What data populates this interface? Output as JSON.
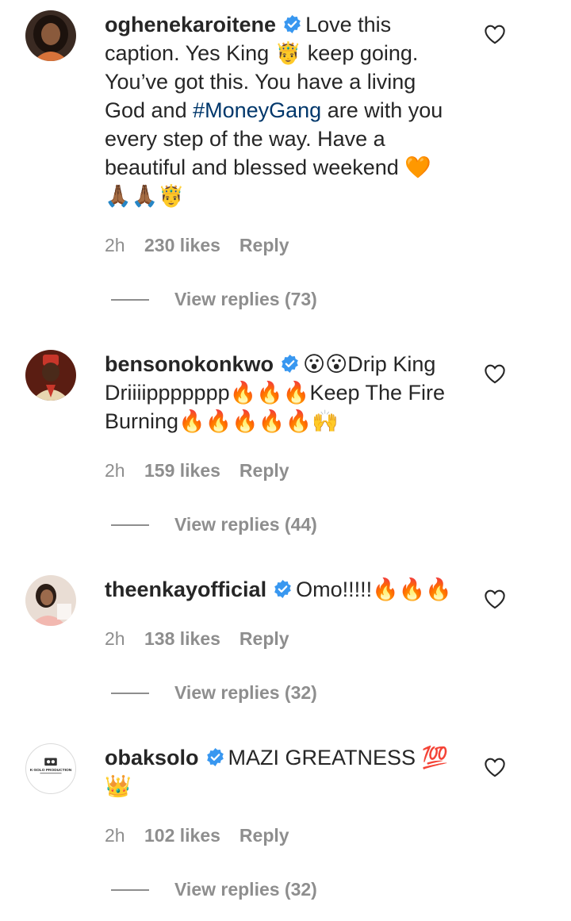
{
  "comments": [
    {
      "username": "oghenekaroitene",
      "text_before": "Love this caption. Yes King 🤴 keep going. You’ve got this. You have a living God and ",
      "hashtag": "#MoneyGang",
      "text_after": " are with you every step of the way. Have a beautiful and blessed weekend 🧡 🙏🏾🙏🏾🤴",
      "time": "2h",
      "likes": "230 likes",
      "reply": "Reply",
      "view_replies": "View replies (73)"
    },
    {
      "username": "bensonokonkwo",
      "text": "😮😮Drip King Driiiippppppp🔥🔥🔥Keep The Fire Burning🔥🔥🔥🔥🔥🙌",
      "time": "2h",
      "likes": "159 likes",
      "reply": "Reply",
      "view_replies": "View replies (44)"
    },
    {
      "username": "theenkayofficial",
      "text": "Omo!!!!!🔥🔥🔥",
      "time": "2h",
      "likes": "138 likes",
      "reply": "Reply",
      "view_replies": "View replies (32)"
    },
    {
      "username": "obaksolo",
      "text": "MAZI GREATNESS 💯 👑",
      "avatar_text": "K-SOLO PRODUCTION",
      "time": "2h",
      "likes": "102 likes",
      "reply": "Reply",
      "view_replies": "View replies (32)"
    }
  ],
  "colors": {
    "text": "#262626",
    "secondary": "#8e8e8e",
    "hashtag": "#00376b",
    "verified": "#3897f0"
  },
  "icons": {
    "verified": "verified-badge-icon",
    "like": "heart-outline-icon"
  }
}
